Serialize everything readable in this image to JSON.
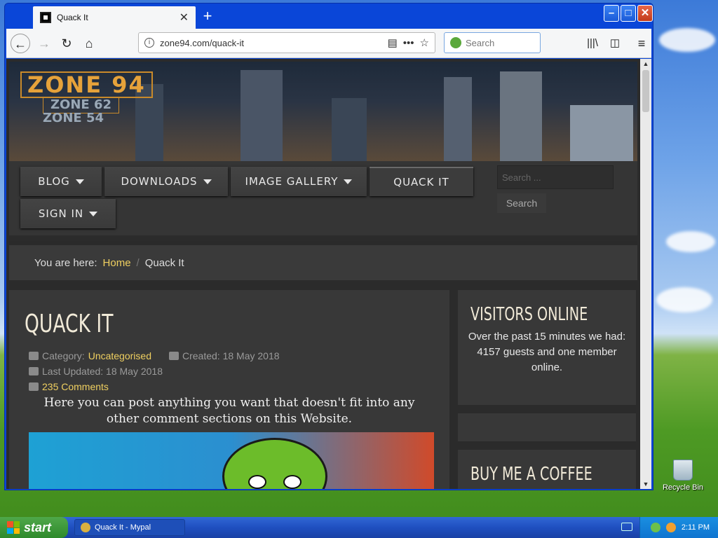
{
  "browser": {
    "tab_title": "Quack It",
    "url": "zone94.com/quack-it",
    "search_placeholder": "Search",
    "new_tab": "+",
    "tab_close": "✕"
  },
  "site": {
    "logo": {
      "line1": "ZONE 94",
      "line2": "ZONE 62",
      "line3": "ZONE 54"
    },
    "menu": [
      {
        "label": "BLOG",
        "has_caret": true
      },
      {
        "label": "DOWNLOADS",
        "has_caret": true
      },
      {
        "label": "IMAGE GALLERY",
        "has_caret": true
      },
      {
        "label": "QUACK IT",
        "has_caret": false,
        "active": true
      },
      {
        "label": "SIGN IN",
        "has_caret": true
      }
    ],
    "menu_search_placeholder": "Search ...",
    "menu_search_button": "Search",
    "breadcrumb": {
      "label": "You are here:",
      "home": "Home",
      "current": "Quack It"
    },
    "article": {
      "title": "QUACK IT",
      "category_label": "Category:",
      "category": "Uncategorised",
      "created": "Created: 18 May 2018",
      "updated": "Last Updated: 18 May 2018",
      "comments": "235 Comments",
      "body": "Here you can post anything you want that doesn't fit into any other comment sections on this Website."
    },
    "visitors": {
      "title": "VISITORS ONLINE",
      "text": "Over the past 15 minutes we had:",
      "count": "4157 guests and one member online."
    },
    "coffee_title": "BUY ME A COFFEE"
  },
  "desktop": {
    "recycle_bin": "Recycle Bin",
    "start": "start",
    "taskbar_item": "Quack It - Mypal",
    "clock": "2:11 PM"
  },
  "colors": {
    "accent_link": "#f0d060",
    "xp_blue": "#0a46d8",
    "start_green": "#3b9a38"
  }
}
